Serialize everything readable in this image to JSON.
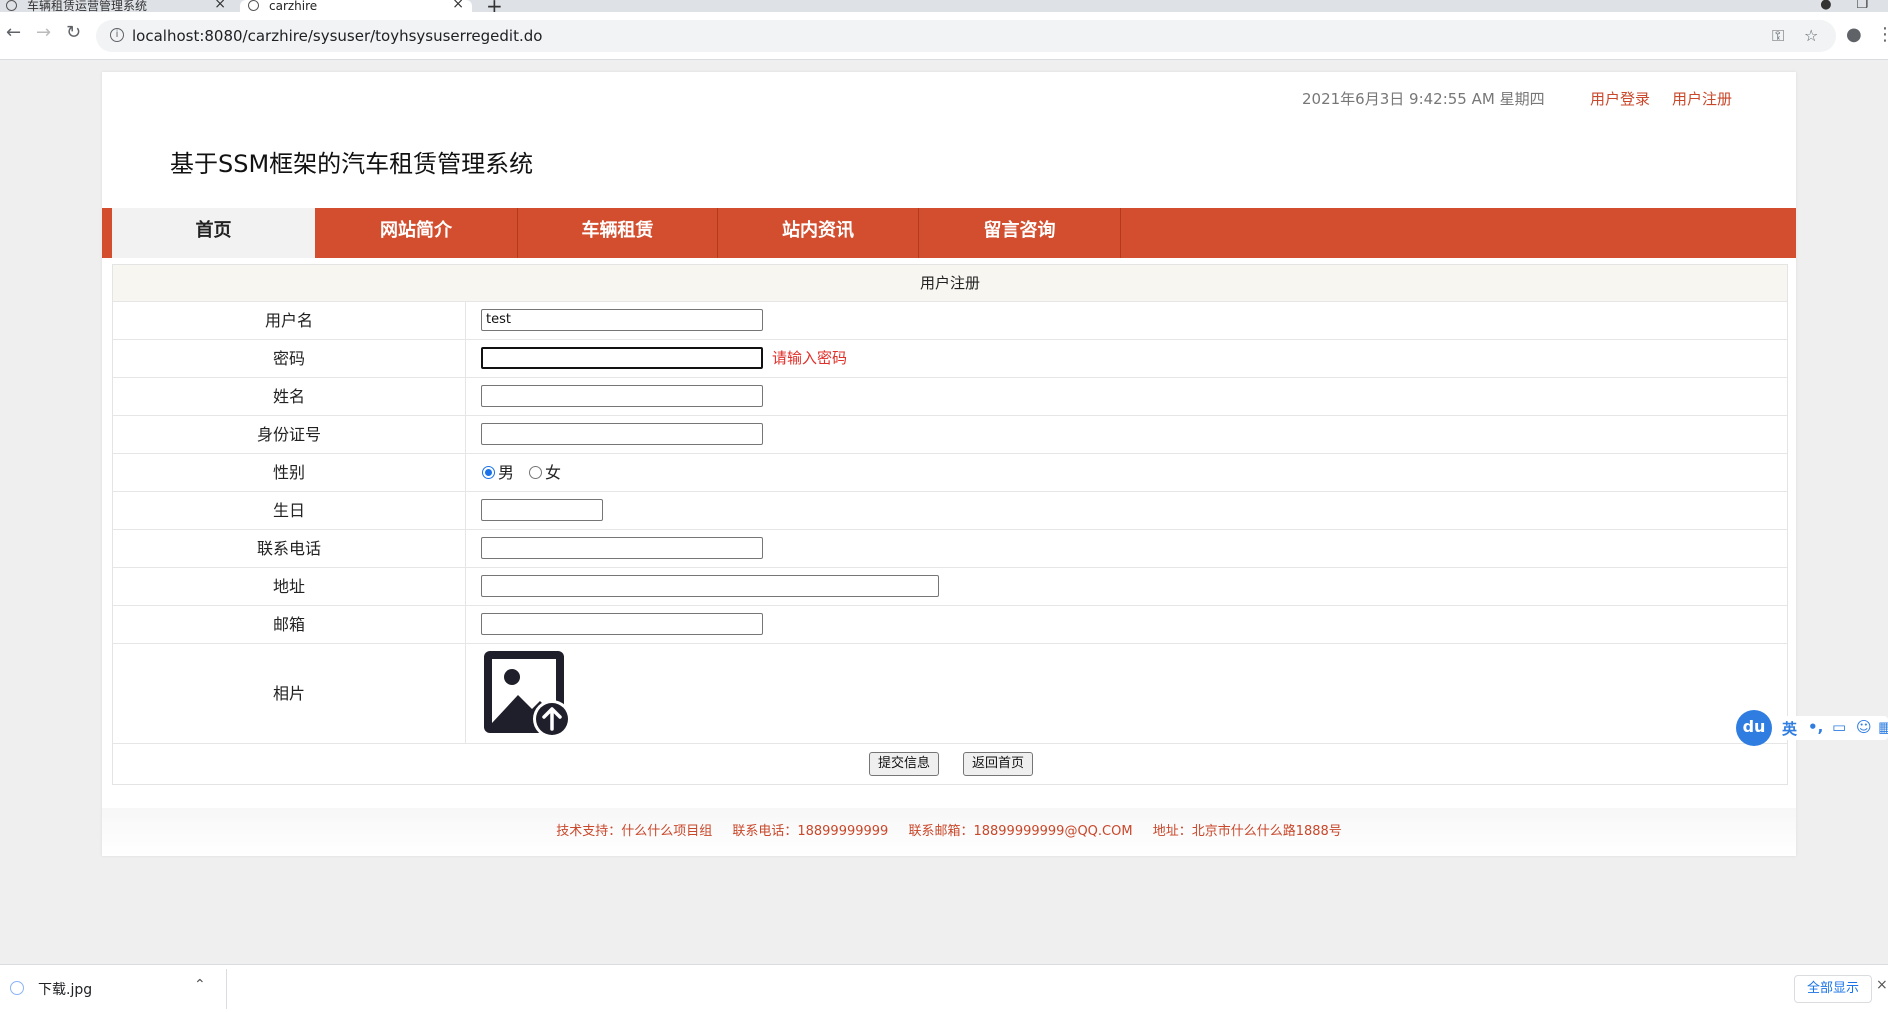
{
  "browser": {
    "tabs": [
      {
        "title": "车辆租赁运营管理系统"
      },
      {
        "title": "carzhire"
      }
    ],
    "new_tab": "+",
    "url": "localhost:8080/carzhire/sysuser/toyhsysuserregedit.do"
  },
  "header": {
    "datetime": "2021年6月3日 9:42:55 AM 星期四",
    "login_link": "用户登录",
    "register_link": "用户注册",
    "site_title": "基于SSM框架的汽车租赁管理系统"
  },
  "nav": {
    "items": [
      {
        "label": "首页"
      },
      {
        "label": "网站简介"
      },
      {
        "label": "车辆租赁"
      },
      {
        "label": "站内资讯"
      },
      {
        "label": "留言咨询"
      }
    ]
  },
  "form": {
    "title": "用户注册",
    "username": {
      "label": "用户名",
      "value": "test"
    },
    "password": {
      "label": "密码",
      "value": "",
      "error": "请输入密码"
    },
    "name": {
      "label": "姓名",
      "value": ""
    },
    "id_number": {
      "label": "身份证号",
      "value": ""
    },
    "gender": {
      "label": "性别",
      "options": [
        "男",
        "女"
      ],
      "selected": "男"
    },
    "birthday": {
      "label": "生日",
      "value": ""
    },
    "phone": {
      "label": "联系电话",
      "value": ""
    },
    "address": {
      "label": "地址",
      "value": ""
    },
    "email": {
      "label": "邮箱",
      "value": ""
    },
    "photo": {
      "label": "相片",
      "icon": "image-upload-icon"
    },
    "submit_label": "提交信息",
    "back_label": "返回首页"
  },
  "footer": {
    "support": "技术支持：什么什么项目组",
    "phone": "联系电话：18899999999",
    "email": "联系邮箱：18899999999@QQ.COM",
    "address": "地址：北京市什么什么路1888号"
  },
  "ime": {
    "logo": "du",
    "lang": "英"
  },
  "downloads": {
    "file_name": "下载.jpg",
    "show_all": "全部显示"
  },
  "colors": {
    "nav_bg": "#d24e2e",
    "link": "#c9472a",
    "error": "#e0302a"
  }
}
